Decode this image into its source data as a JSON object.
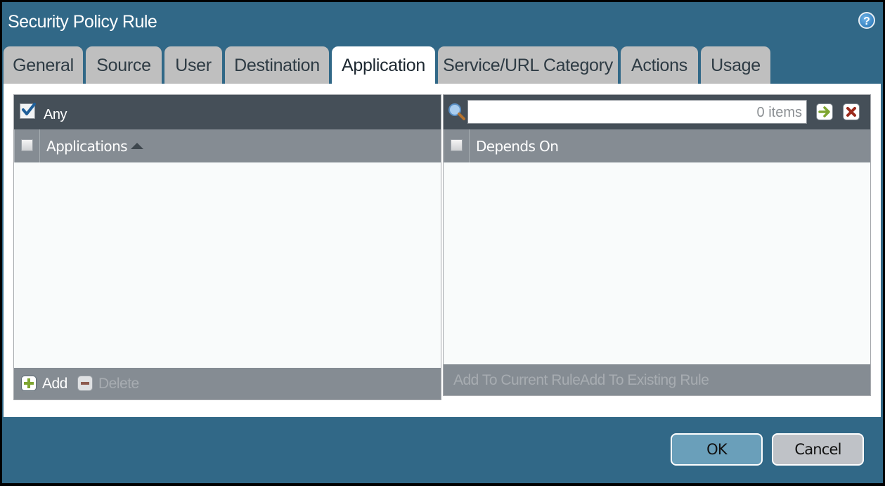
{
  "dialog": {
    "title": "Security Policy Rule",
    "help_icon": "help-icon"
  },
  "tabs": [
    {
      "label": "General",
      "active": false
    },
    {
      "label": "Source",
      "active": false
    },
    {
      "label": "User",
      "active": false
    },
    {
      "label": "Destination",
      "active": false
    },
    {
      "label": "Application",
      "active": true
    },
    {
      "label": "Service/URL Category",
      "active": false
    },
    {
      "label": "Actions",
      "active": false
    },
    {
      "label": "Usage",
      "active": false
    }
  ],
  "applications_panel": {
    "any_label": "Any",
    "any_checked": true,
    "column_header": "Applications",
    "sort": "ascending",
    "rows": [],
    "add_label": "Add",
    "delete_label": "Delete"
  },
  "depends_panel": {
    "search_value": "",
    "items_count": "0 items",
    "column_header": "Depends On",
    "rows": [],
    "add_current_label": "Add To Current Rule",
    "add_existing_label": "Add To Existing Rule"
  },
  "footer": {
    "ok_label": "OK",
    "cancel_label": "Cancel"
  },
  "colors": {
    "dialog_bg": "#316887",
    "tab_inactive": "#bfbfbf",
    "panel_header_dark": "#454f58",
    "panel_header": "#858c93",
    "ok_button": "#6a9fba",
    "cancel_button": "#bfc2c7"
  }
}
